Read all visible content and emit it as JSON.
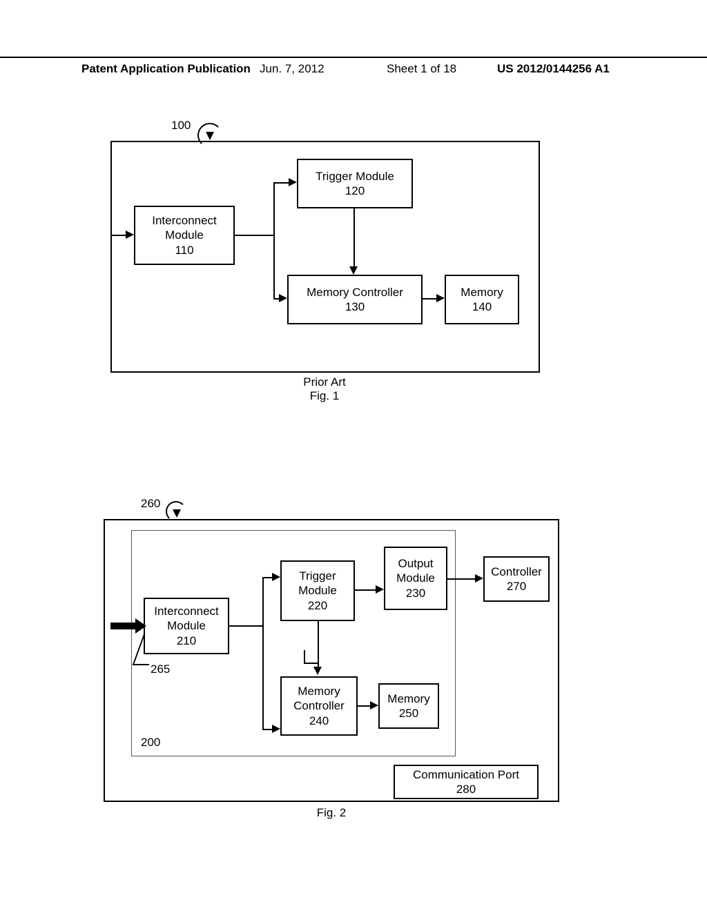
{
  "header": {
    "left": "Patent Application Publication",
    "date": "Jun. 7, 2012",
    "sheet": "Sheet 1 of 18",
    "pubno": "US 2012/0144256 A1"
  },
  "fig1": {
    "ref100": "100",
    "interconnect": {
      "l1": "Interconnect",
      "l2": "Module",
      "l3": "110"
    },
    "trigger": {
      "l1": "Trigger Module",
      "l2": "120"
    },
    "memctrl": {
      "l1": "Memory Controller",
      "l2": "130"
    },
    "memory": {
      "l1": "Memory",
      "l2": "140"
    },
    "caption1": "Prior Art",
    "caption2": "Fig. 1"
  },
  "fig2": {
    "ref260": "260",
    "ref265": "265",
    "ref200": "200",
    "interconnect": {
      "l1": "Interconnect",
      "l2": "Module",
      "l3": "210"
    },
    "trigger": {
      "l1": "Trigger",
      "l2": "Module",
      "l3": "220"
    },
    "output": {
      "l1": "Output",
      "l2": "Module",
      "l3": "230"
    },
    "controller": {
      "l1": "Controller",
      "l2": "270"
    },
    "memctrl": {
      "l1": "Memory",
      "l2": "Controller",
      "l3": "240"
    },
    "memory": {
      "l1": "Memory",
      "l2": "250"
    },
    "comm": {
      "l1": "Communication Port",
      "l2": "280"
    },
    "caption": "Fig. 2"
  }
}
